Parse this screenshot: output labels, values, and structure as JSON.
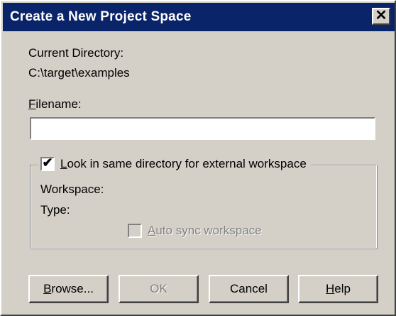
{
  "dialog": {
    "title": "Create a New Project Space",
    "close_glyph": "✕"
  },
  "current_directory": {
    "label": "Current Directory:",
    "value": "C:\\target\\examples"
  },
  "filename": {
    "label_mnemonic": "F",
    "label_rest": "ilename:",
    "value": "",
    "placeholder": ""
  },
  "workspace_group": {
    "checkbox_mnemonic": "L",
    "checkbox_rest": "ook in same directory for external workspace",
    "checked": true,
    "check_glyph": "✔",
    "workspace_label": "Workspace:",
    "type_label": "Type:",
    "auto_sync_mnemonic": "A",
    "auto_sync_rest": "uto sync workspace",
    "auto_sync_enabled": false
  },
  "buttons": {
    "browse_mnemonic": "B",
    "browse_rest": "rowse...",
    "ok": "OK",
    "ok_enabled": false,
    "cancel": "Cancel",
    "help_mnemonic": "H",
    "help_rest": "elp"
  },
  "icons": {
    "close": "close-icon",
    "check": "checkmark-icon"
  },
  "colors": {
    "title_bar": "#0a246a",
    "face": "#d4d0c8",
    "disabled_text": "#808080"
  }
}
